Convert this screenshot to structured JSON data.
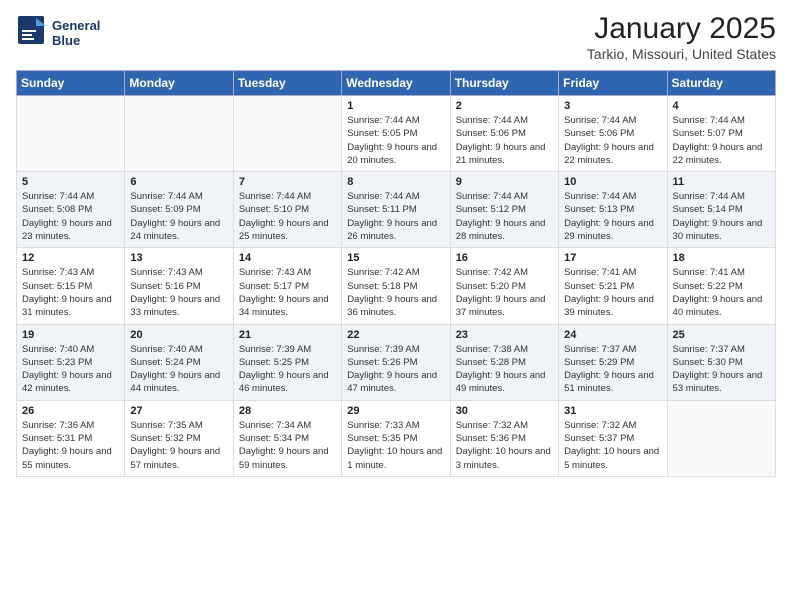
{
  "header": {
    "logo_line1": "General",
    "logo_line2": "Blue",
    "title": "January 2025",
    "subtitle": "Tarkio, Missouri, United States"
  },
  "weekdays": [
    "Sunday",
    "Monday",
    "Tuesday",
    "Wednesday",
    "Thursday",
    "Friday",
    "Saturday"
  ],
  "weeks": [
    [
      {
        "day": "",
        "sunrise": "",
        "sunset": "",
        "daylight": ""
      },
      {
        "day": "",
        "sunrise": "",
        "sunset": "",
        "daylight": ""
      },
      {
        "day": "",
        "sunrise": "",
        "sunset": "",
        "daylight": ""
      },
      {
        "day": "1",
        "sunrise": "Sunrise: 7:44 AM",
        "sunset": "Sunset: 5:05 PM",
        "daylight": "Daylight: 9 hours and 20 minutes."
      },
      {
        "day": "2",
        "sunrise": "Sunrise: 7:44 AM",
        "sunset": "Sunset: 5:06 PM",
        "daylight": "Daylight: 9 hours and 21 minutes."
      },
      {
        "day": "3",
        "sunrise": "Sunrise: 7:44 AM",
        "sunset": "Sunset: 5:06 PM",
        "daylight": "Daylight: 9 hours and 22 minutes."
      },
      {
        "day": "4",
        "sunrise": "Sunrise: 7:44 AM",
        "sunset": "Sunset: 5:07 PM",
        "daylight": "Daylight: 9 hours and 22 minutes."
      }
    ],
    [
      {
        "day": "5",
        "sunrise": "Sunrise: 7:44 AM",
        "sunset": "Sunset: 5:08 PM",
        "daylight": "Daylight: 9 hours and 23 minutes."
      },
      {
        "day": "6",
        "sunrise": "Sunrise: 7:44 AM",
        "sunset": "Sunset: 5:09 PM",
        "daylight": "Daylight: 9 hours and 24 minutes."
      },
      {
        "day": "7",
        "sunrise": "Sunrise: 7:44 AM",
        "sunset": "Sunset: 5:10 PM",
        "daylight": "Daylight: 9 hours and 25 minutes."
      },
      {
        "day": "8",
        "sunrise": "Sunrise: 7:44 AM",
        "sunset": "Sunset: 5:11 PM",
        "daylight": "Daylight: 9 hours and 26 minutes."
      },
      {
        "day": "9",
        "sunrise": "Sunrise: 7:44 AM",
        "sunset": "Sunset: 5:12 PM",
        "daylight": "Daylight: 9 hours and 28 minutes."
      },
      {
        "day": "10",
        "sunrise": "Sunrise: 7:44 AM",
        "sunset": "Sunset: 5:13 PM",
        "daylight": "Daylight: 9 hours and 29 minutes."
      },
      {
        "day": "11",
        "sunrise": "Sunrise: 7:44 AM",
        "sunset": "Sunset: 5:14 PM",
        "daylight": "Daylight: 9 hours and 30 minutes."
      }
    ],
    [
      {
        "day": "12",
        "sunrise": "Sunrise: 7:43 AM",
        "sunset": "Sunset: 5:15 PM",
        "daylight": "Daylight: 9 hours and 31 minutes."
      },
      {
        "day": "13",
        "sunrise": "Sunrise: 7:43 AM",
        "sunset": "Sunset: 5:16 PM",
        "daylight": "Daylight: 9 hours and 33 minutes."
      },
      {
        "day": "14",
        "sunrise": "Sunrise: 7:43 AM",
        "sunset": "Sunset: 5:17 PM",
        "daylight": "Daylight: 9 hours and 34 minutes."
      },
      {
        "day": "15",
        "sunrise": "Sunrise: 7:42 AM",
        "sunset": "Sunset: 5:18 PM",
        "daylight": "Daylight: 9 hours and 36 minutes."
      },
      {
        "day": "16",
        "sunrise": "Sunrise: 7:42 AM",
        "sunset": "Sunset: 5:20 PM",
        "daylight": "Daylight: 9 hours and 37 minutes."
      },
      {
        "day": "17",
        "sunrise": "Sunrise: 7:41 AM",
        "sunset": "Sunset: 5:21 PM",
        "daylight": "Daylight: 9 hours and 39 minutes."
      },
      {
        "day": "18",
        "sunrise": "Sunrise: 7:41 AM",
        "sunset": "Sunset: 5:22 PM",
        "daylight": "Daylight: 9 hours and 40 minutes."
      }
    ],
    [
      {
        "day": "19",
        "sunrise": "Sunrise: 7:40 AM",
        "sunset": "Sunset: 5:23 PM",
        "daylight": "Daylight: 9 hours and 42 minutes."
      },
      {
        "day": "20",
        "sunrise": "Sunrise: 7:40 AM",
        "sunset": "Sunset: 5:24 PM",
        "daylight": "Daylight: 9 hours and 44 minutes."
      },
      {
        "day": "21",
        "sunrise": "Sunrise: 7:39 AM",
        "sunset": "Sunset: 5:25 PM",
        "daylight": "Daylight: 9 hours and 46 minutes."
      },
      {
        "day": "22",
        "sunrise": "Sunrise: 7:39 AM",
        "sunset": "Sunset: 5:26 PM",
        "daylight": "Daylight: 9 hours and 47 minutes."
      },
      {
        "day": "23",
        "sunrise": "Sunrise: 7:38 AM",
        "sunset": "Sunset: 5:28 PM",
        "daylight": "Daylight: 9 hours and 49 minutes."
      },
      {
        "day": "24",
        "sunrise": "Sunrise: 7:37 AM",
        "sunset": "Sunset: 5:29 PM",
        "daylight": "Daylight: 9 hours and 51 minutes."
      },
      {
        "day": "25",
        "sunrise": "Sunrise: 7:37 AM",
        "sunset": "Sunset: 5:30 PM",
        "daylight": "Daylight: 9 hours and 53 minutes."
      }
    ],
    [
      {
        "day": "26",
        "sunrise": "Sunrise: 7:36 AM",
        "sunset": "Sunset: 5:31 PM",
        "daylight": "Daylight: 9 hours and 55 minutes."
      },
      {
        "day": "27",
        "sunrise": "Sunrise: 7:35 AM",
        "sunset": "Sunset: 5:32 PM",
        "daylight": "Daylight: 9 hours and 57 minutes."
      },
      {
        "day": "28",
        "sunrise": "Sunrise: 7:34 AM",
        "sunset": "Sunset: 5:34 PM",
        "daylight": "Daylight: 9 hours and 59 minutes."
      },
      {
        "day": "29",
        "sunrise": "Sunrise: 7:33 AM",
        "sunset": "Sunset: 5:35 PM",
        "daylight": "Daylight: 10 hours and 1 minute."
      },
      {
        "day": "30",
        "sunrise": "Sunrise: 7:32 AM",
        "sunset": "Sunset: 5:36 PM",
        "daylight": "Daylight: 10 hours and 3 minutes."
      },
      {
        "day": "31",
        "sunrise": "Sunrise: 7:32 AM",
        "sunset": "Sunset: 5:37 PM",
        "daylight": "Daylight: 10 hours and 5 minutes."
      },
      {
        "day": "",
        "sunrise": "",
        "sunset": "",
        "daylight": ""
      }
    ]
  ]
}
